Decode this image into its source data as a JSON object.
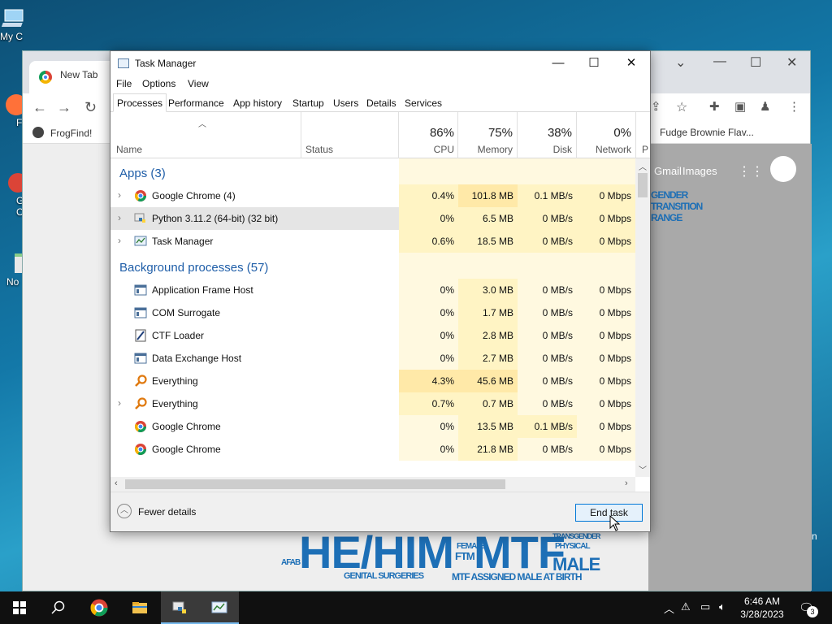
{
  "desktop": {
    "icons": [
      {
        "label": "My C"
      },
      {
        "label": "F"
      },
      {
        "label": "G"
      },
      {
        "label": "C"
      },
      {
        "label": "No"
      }
    ],
    "right_fragment": "n"
  },
  "chrome": {
    "tab_title": "New Tab",
    "bookmark_left": "FrogFind!",
    "bookmark_right": "Fudge Brownie Flav...",
    "links": [
      "Gmail",
      "Images"
    ],
    "wordcloud": [
      "HE/HIM",
      "MTF",
      "FTM",
      "MALE",
      "GENDER",
      "TRANSITION",
      "RANGE",
      "GENITAL SURGERIES",
      "MTF ASSIGNED MALE AT BIRTH",
      "PHYSICAL",
      "FEMALE",
      "AFAB",
      "TRANSGENDER"
    ]
  },
  "task_manager": {
    "title": "Task Manager",
    "menu": [
      "File",
      "Options",
      "View"
    ],
    "tabs": [
      "Processes",
      "Performance",
      "App history",
      "Startup",
      "Users",
      "Details",
      "Services"
    ],
    "active_tab": "Processes",
    "columns": {
      "name": "Name",
      "status": "Status",
      "cpu": {
        "pct": "86%",
        "label": "CPU"
      },
      "memory": {
        "pct": "75%",
        "label": "Memory"
      },
      "disk": {
        "pct": "38%",
        "label": "Disk"
      },
      "network": {
        "pct": "0%",
        "label": "Network"
      },
      "power_fragment": "P"
    },
    "groups": [
      {
        "title": "Apps (3)",
        "rows": [
          {
            "name": "Google Chrome (4)",
            "icon": "chrome-icon",
            "expandable": true,
            "cpu": "0.4%",
            "memory": "101.8 MB",
            "disk": "0.1 MB/s",
            "network": "0 Mbps"
          },
          {
            "name": "Python 3.11.2 (64-bit) (32 bit)",
            "icon": "python-icon",
            "expandable": true,
            "selected": true,
            "cpu": "0%",
            "memory": "6.5 MB",
            "disk": "0 MB/s",
            "network": "0 Mbps"
          },
          {
            "name": "Task Manager",
            "icon": "task-manager-icon",
            "expandable": true,
            "cpu": "0.6%",
            "memory": "18.5 MB",
            "disk": "0 MB/s",
            "network": "0 Mbps"
          }
        ]
      },
      {
        "title": "Background processes (57)",
        "rows": [
          {
            "name": "Application Frame Host",
            "icon": "window-app-icon",
            "expandable": false,
            "cpu": "0%",
            "memory": "3.0 MB",
            "disk": "0 MB/s",
            "network": "0 Mbps"
          },
          {
            "name": "COM Surrogate",
            "icon": "window-app-icon",
            "expandable": false,
            "cpu": "0%",
            "memory": "1.7 MB",
            "disk": "0 MB/s",
            "network": "0 Mbps"
          },
          {
            "name": "CTF Loader",
            "icon": "ctf-loader-icon",
            "expandable": false,
            "cpu": "0%",
            "memory": "2.8 MB",
            "disk": "0 MB/s",
            "network": "0 Mbps"
          },
          {
            "name": "Data Exchange Host",
            "icon": "window-app-icon",
            "expandable": false,
            "cpu": "0%",
            "memory": "2.7 MB",
            "disk": "0 MB/s",
            "network": "0 Mbps"
          },
          {
            "name": "Everything",
            "icon": "everything-search-icon",
            "expandable": false,
            "cpu": "4.3%",
            "memory": "45.6 MB",
            "disk": "0 MB/s",
            "network": "0 Mbps"
          },
          {
            "name": "Everything",
            "icon": "everything-search-icon",
            "expandable": true,
            "cpu": "0.7%",
            "memory": "0.7 MB",
            "disk": "0 MB/s",
            "network": "0 Mbps"
          },
          {
            "name": "Google Chrome",
            "icon": "chrome-icon",
            "expandable": false,
            "cpu": "0%",
            "memory": "13.5 MB",
            "disk": "0.1 MB/s",
            "network": "0 Mbps"
          },
          {
            "name": "Google Chrome",
            "icon": "chrome-icon",
            "expandable": false,
            "cpu": "0%",
            "memory": "21.8 MB",
            "disk": "0 MB/s",
            "network": "0 Mbps"
          }
        ]
      }
    ],
    "footer": {
      "fewer_details": "Fewer details",
      "end_task": "End task"
    }
  },
  "taskbar": {
    "clock_time": "6:46 AM",
    "clock_date": "3/28/2023",
    "notification_count": "3"
  }
}
